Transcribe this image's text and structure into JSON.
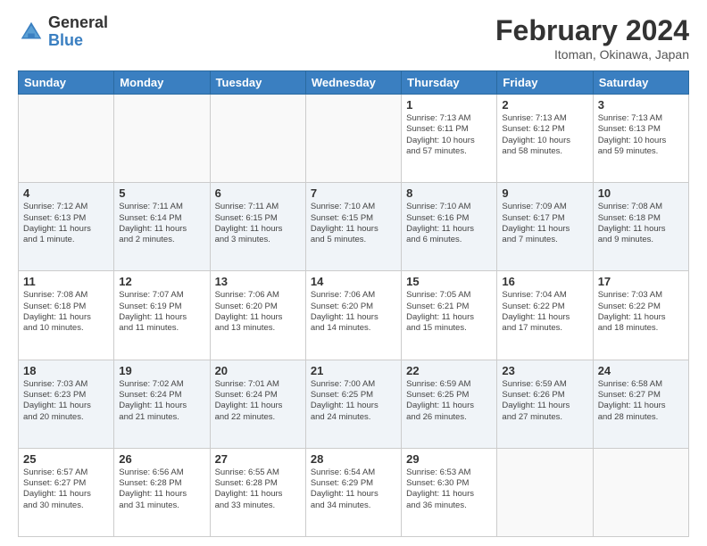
{
  "logo": {
    "general": "General",
    "blue": "Blue"
  },
  "title": "February 2024",
  "location": "Itoman, Okinawa, Japan",
  "days_of_week": [
    "Sunday",
    "Monday",
    "Tuesday",
    "Wednesday",
    "Thursday",
    "Friday",
    "Saturday"
  ],
  "weeks": [
    [
      {
        "day": "",
        "info": ""
      },
      {
        "day": "",
        "info": ""
      },
      {
        "day": "",
        "info": ""
      },
      {
        "day": "",
        "info": ""
      },
      {
        "day": "1",
        "info": "Sunrise: 7:13 AM\nSunset: 6:11 PM\nDaylight: 10 hours\nand 57 minutes."
      },
      {
        "day": "2",
        "info": "Sunrise: 7:13 AM\nSunset: 6:12 PM\nDaylight: 10 hours\nand 58 minutes."
      },
      {
        "day": "3",
        "info": "Sunrise: 7:13 AM\nSunset: 6:13 PM\nDaylight: 10 hours\nand 59 minutes."
      }
    ],
    [
      {
        "day": "4",
        "info": "Sunrise: 7:12 AM\nSunset: 6:13 PM\nDaylight: 11 hours\nand 1 minute."
      },
      {
        "day": "5",
        "info": "Sunrise: 7:11 AM\nSunset: 6:14 PM\nDaylight: 11 hours\nand 2 minutes."
      },
      {
        "day": "6",
        "info": "Sunrise: 7:11 AM\nSunset: 6:15 PM\nDaylight: 11 hours\nand 3 minutes."
      },
      {
        "day": "7",
        "info": "Sunrise: 7:10 AM\nSunset: 6:15 PM\nDaylight: 11 hours\nand 5 minutes."
      },
      {
        "day": "8",
        "info": "Sunrise: 7:10 AM\nSunset: 6:16 PM\nDaylight: 11 hours\nand 6 minutes."
      },
      {
        "day": "9",
        "info": "Sunrise: 7:09 AM\nSunset: 6:17 PM\nDaylight: 11 hours\nand 7 minutes."
      },
      {
        "day": "10",
        "info": "Sunrise: 7:08 AM\nSunset: 6:18 PM\nDaylight: 11 hours\nand 9 minutes."
      }
    ],
    [
      {
        "day": "11",
        "info": "Sunrise: 7:08 AM\nSunset: 6:18 PM\nDaylight: 11 hours\nand 10 minutes."
      },
      {
        "day": "12",
        "info": "Sunrise: 7:07 AM\nSunset: 6:19 PM\nDaylight: 11 hours\nand 11 minutes."
      },
      {
        "day": "13",
        "info": "Sunrise: 7:06 AM\nSunset: 6:20 PM\nDaylight: 11 hours\nand 13 minutes."
      },
      {
        "day": "14",
        "info": "Sunrise: 7:06 AM\nSunset: 6:20 PM\nDaylight: 11 hours\nand 14 minutes."
      },
      {
        "day": "15",
        "info": "Sunrise: 7:05 AM\nSunset: 6:21 PM\nDaylight: 11 hours\nand 15 minutes."
      },
      {
        "day": "16",
        "info": "Sunrise: 7:04 AM\nSunset: 6:22 PM\nDaylight: 11 hours\nand 17 minutes."
      },
      {
        "day": "17",
        "info": "Sunrise: 7:03 AM\nSunset: 6:22 PM\nDaylight: 11 hours\nand 18 minutes."
      }
    ],
    [
      {
        "day": "18",
        "info": "Sunrise: 7:03 AM\nSunset: 6:23 PM\nDaylight: 11 hours\nand 20 minutes."
      },
      {
        "day": "19",
        "info": "Sunrise: 7:02 AM\nSunset: 6:24 PM\nDaylight: 11 hours\nand 21 minutes."
      },
      {
        "day": "20",
        "info": "Sunrise: 7:01 AM\nSunset: 6:24 PM\nDaylight: 11 hours\nand 22 minutes."
      },
      {
        "day": "21",
        "info": "Sunrise: 7:00 AM\nSunset: 6:25 PM\nDaylight: 11 hours\nand 24 minutes."
      },
      {
        "day": "22",
        "info": "Sunrise: 6:59 AM\nSunset: 6:25 PM\nDaylight: 11 hours\nand 26 minutes."
      },
      {
        "day": "23",
        "info": "Sunrise: 6:59 AM\nSunset: 6:26 PM\nDaylight: 11 hours\nand 27 minutes."
      },
      {
        "day": "24",
        "info": "Sunrise: 6:58 AM\nSunset: 6:27 PM\nDaylight: 11 hours\nand 28 minutes."
      }
    ],
    [
      {
        "day": "25",
        "info": "Sunrise: 6:57 AM\nSunset: 6:27 PM\nDaylight: 11 hours\nand 30 minutes."
      },
      {
        "day": "26",
        "info": "Sunrise: 6:56 AM\nSunset: 6:28 PM\nDaylight: 11 hours\nand 31 minutes."
      },
      {
        "day": "27",
        "info": "Sunrise: 6:55 AM\nSunset: 6:28 PM\nDaylight: 11 hours\nand 33 minutes."
      },
      {
        "day": "28",
        "info": "Sunrise: 6:54 AM\nSunset: 6:29 PM\nDaylight: 11 hours\nand 34 minutes."
      },
      {
        "day": "29",
        "info": "Sunrise: 6:53 AM\nSunset: 6:30 PM\nDaylight: 11 hours\nand 36 minutes."
      },
      {
        "day": "",
        "info": ""
      },
      {
        "day": "",
        "info": ""
      }
    ]
  ]
}
